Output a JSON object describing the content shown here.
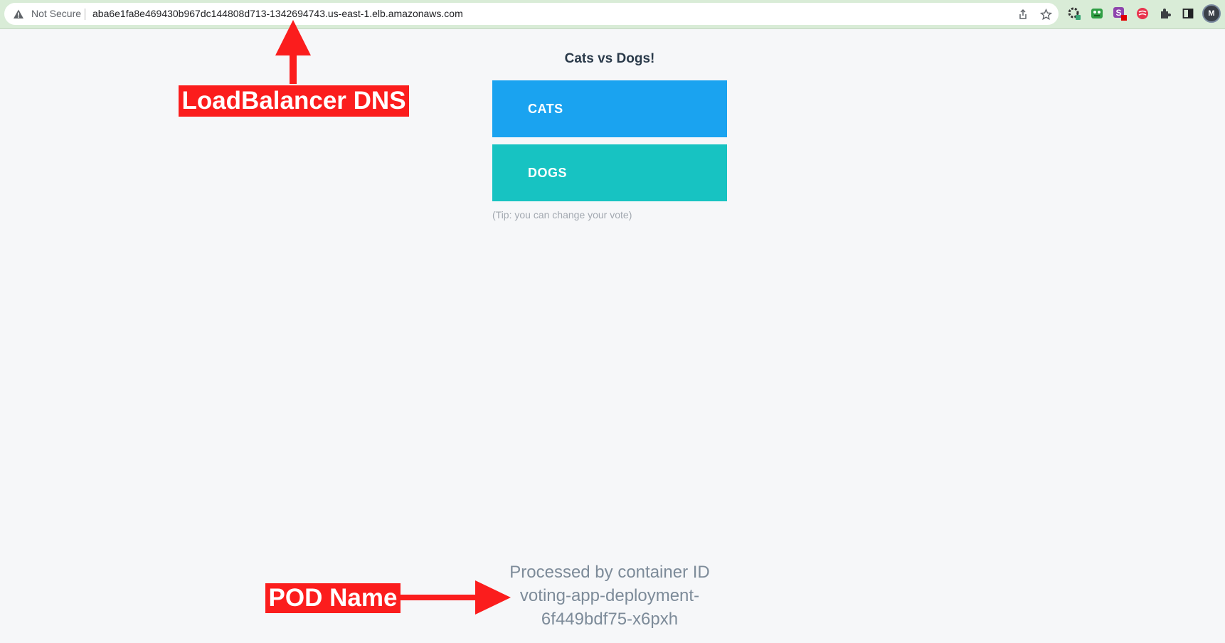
{
  "browser": {
    "security_label": "Not Secure",
    "url": "aba6e1fa8e469430b967dc144808d713-1342694743.us-east-1.elb.amazonaws.com",
    "icons": [
      "warning-icon",
      "share-icon",
      "bookmark-star-icon",
      "extension-gear-icon",
      "extension-frog-icon",
      "extension-s-icon",
      "extension-red-icon",
      "puzzle-icon",
      "sidebar-icon",
      "profile-avatar"
    ],
    "avatar_initial": "M"
  },
  "app": {
    "title": "Cats vs Dogs!",
    "option_a": "CATS",
    "option_b": "DOGS",
    "tip": "(Tip: you can change your vote)",
    "processed_line1": "Processed by container ID",
    "processed_line2": "voting-app-deployment-",
    "processed_line3": "6f449bdf75-x6pxh"
  },
  "annotations": {
    "loadbalancer_label": "LoadBalancer DNS",
    "pod_label": "POD Name"
  },
  "colors": {
    "cats": "#1aa3f0",
    "dogs": "#17c3c2",
    "annotation_red": "#fb1d1d",
    "toolbar": "#d9ecd7"
  }
}
